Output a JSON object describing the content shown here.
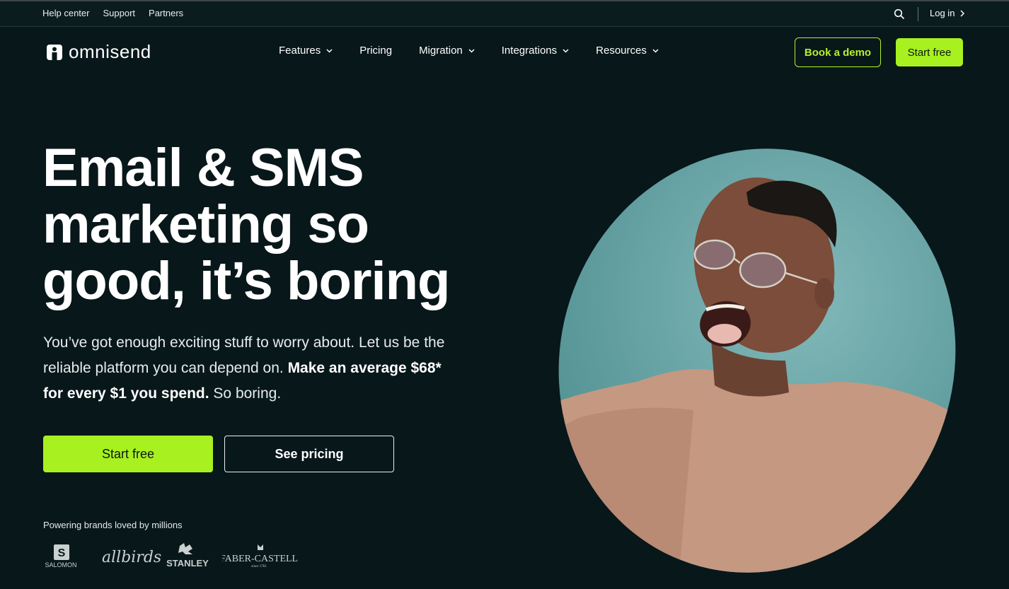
{
  "topbar": {
    "links": [
      "Help center",
      "Support",
      "Partners"
    ],
    "search_icon": "search-icon",
    "login_label": "Log in"
  },
  "brand": {
    "name": "omnisend"
  },
  "nav": {
    "items": [
      {
        "label": "Features",
        "has_dropdown": true
      },
      {
        "label": "Pricing",
        "has_dropdown": false
      },
      {
        "label": "Migration",
        "has_dropdown": true
      },
      {
        "label": "Integrations",
        "has_dropdown": true
      },
      {
        "label": "Resources",
        "has_dropdown": true
      }
    ],
    "book_demo_label": "Book a demo",
    "start_free_label": "Start free"
  },
  "hero": {
    "headline_lines": [
      "Email & SMS",
      "marketing so",
      "good, it’s boring"
    ],
    "subtext_plain": "You’ve got enough exciting stuff to worry about. Let us be the reliable platform you can depend on. ",
    "subtext_strong": "Make an average $68* for every $1 you spend.",
    "subtext_tail": " So boring.",
    "cta_primary": "Start free",
    "cta_secondary": "See pricing",
    "brands_caption": "Powering brands loved by millions",
    "brand_logos": [
      "SALOMON",
      "allbirds",
      "STANLEY",
      "FABER-CASTELL"
    ],
    "brand_logo_sub": {
      "faber_castell": "since 1761"
    }
  },
  "colors": {
    "background": "#08171a",
    "accent": "#a8f020",
    "accent_text": "#b6f22c",
    "image_circle": "#5f9d9e",
    "sweater": "#c59881"
  }
}
